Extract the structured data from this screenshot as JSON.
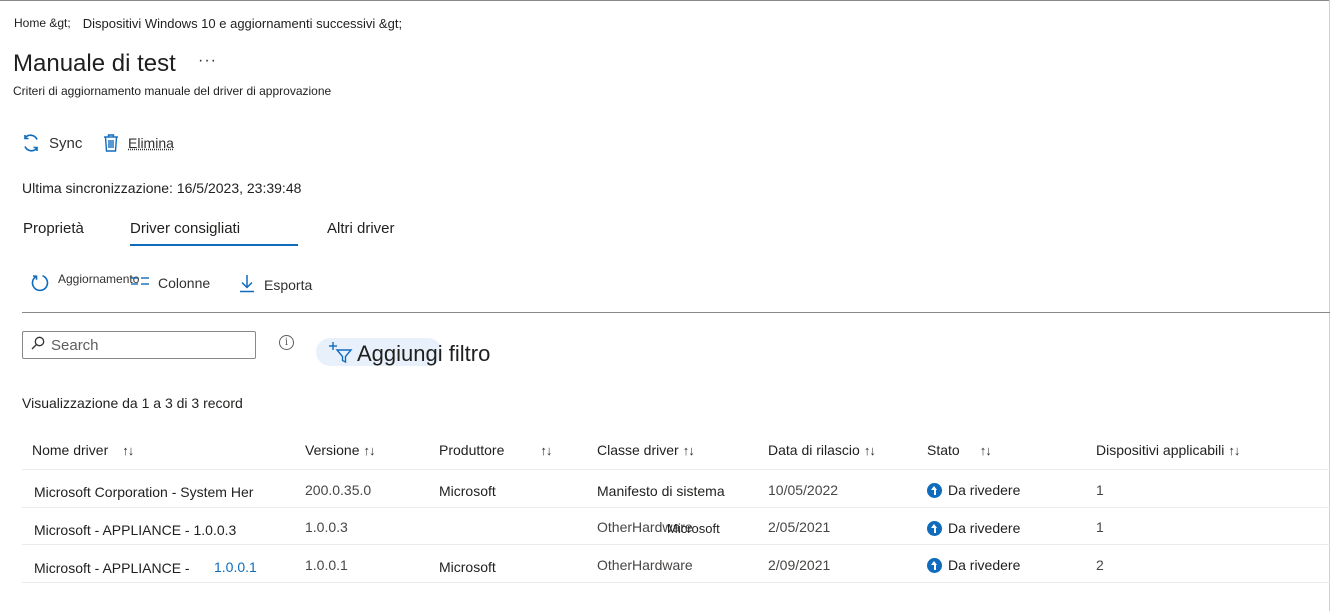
{
  "breadcrumb": {
    "home": "Home &gt;",
    "current": "Dispositivi Windows 10 e aggiornamenti successivi &gt;"
  },
  "page": {
    "title": "Manuale di test",
    "more": "···",
    "subtitle": "Criteri di aggiornamento manuale del driver di approvazione"
  },
  "commands": {
    "sync": "Sync",
    "delete": "Elimina"
  },
  "last_sync": "Ultima sincronizzazione: 16/5/2023, 23:39:48",
  "tabs": [
    {
      "label": "Proprietà"
    },
    {
      "label": "Driver consigliati"
    },
    {
      "label": "Altri driver"
    }
  ],
  "toolbar": {
    "refresh": "Aggiornamento",
    "columns": "Colonne",
    "export": "Esporta"
  },
  "search": {
    "placeholder": "Search",
    "value": ""
  },
  "filter": {
    "label": "Aggiungi filtro"
  },
  "records_text": "Visualizzazione da 1 a 3 di 3 record",
  "table": {
    "headers": [
      "Nome driver",
      "Versione",
      "Produttore",
      "Classe driver",
      "Data di rilascio",
      "Stato",
      "Dispositivi applicabili"
    ],
    "sort_glyph": "↑↓",
    "rows": [
      {
        "name": "Microsoft Corporation - System Her",
        "version": "200.0.35.0",
        "manufacturer": "Microsoft",
        "class": "Manifesto di sistema",
        "date": "10/05/2022",
        "status": "Da rivedere",
        "devices": "1"
      },
      {
        "name": "Microsoft - APPLIANCE - 1.0.0.3",
        "version": "1.0.0.3",
        "manufacturer": "Microsoft",
        "class": "OtherHardware",
        "date": "2/05/2021",
        "status": "Da rivedere",
        "devices": "1"
      },
      {
        "name": "Microsoft - APPLIANCE -",
        "name_link": "1.0.0.1",
        "version": "1.0.0.1",
        "manufacturer": "Microsoft",
        "class": "OtherHardware",
        "date": "2/09/2021",
        "status": "Da rivedere",
        "devices": "2"
      }
    ]
  },
  "colors": {
    "accent": "#0f6cbd",
    "filter_bg": "#e8f1fb"
  }
}
